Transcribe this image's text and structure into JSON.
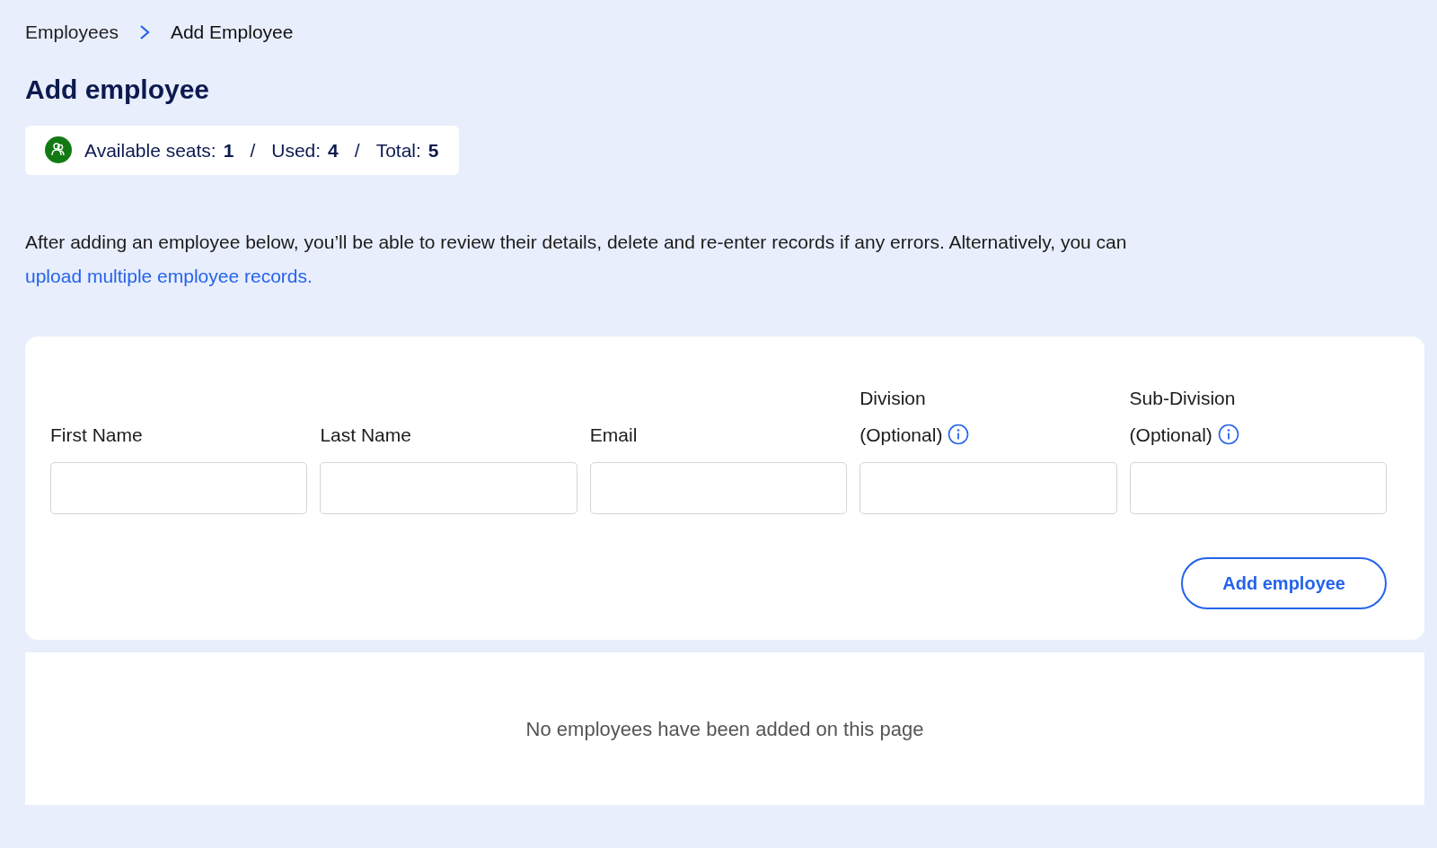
{
  "breadcrumb": [
    {
      "label": "Employees",
      "current": false
    },
    {
      "label": "Add Employee",
      "current": true
    }
  ],
  "title": "Add employee",
  "seats": [
    {
      "label": "Available seats:",
      "value": "1"
    },
    {
      "separator": "/",
      "label": "Used:",
      "value": "4"
    },
    {
      "separator": "/",
      "label": "Total:",
      "value": "5"
    }
  ],
  "intro": {
    "text": "After adding an employee below, you’ll be able to review their details, delete and re-enter records if any errors. Alternatively, you can",
    "link": "upload multiple employee records."
  },
  "fields": [
    {
      "label": "First Name",
      "info": false
    },
    {
      "label": "Last Name",
      "info": false
    },
    {
      "label": "Email",
      "info": false
    },
    {
      "label": "Division",
      "note": "(Optional)",
      "info": true
    },
    {
      "label": "Sub-Division",
      "note": "(Optional)",
      "info": true
    }
  ],
  "add_button": "Add employee",
  "empty_message": "No employees have been added on this page"
}
